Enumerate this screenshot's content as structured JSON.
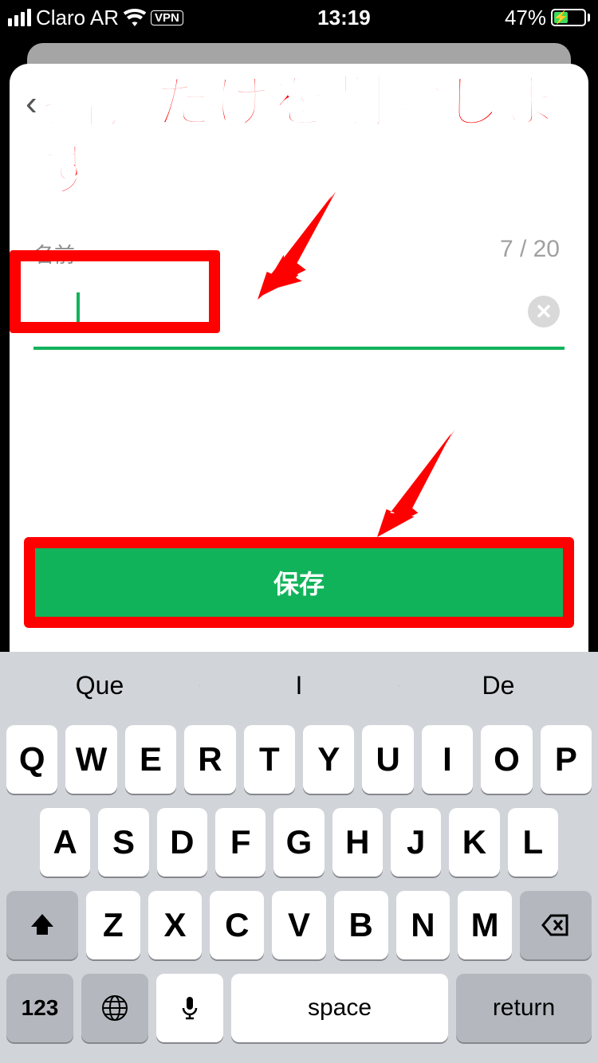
{
  "statusbar": {
    "carrier": "Claro AR",
    "vpn_label": "VPN",
    "time": "13:19",
    "battery_text": "47%",
    "battery_percent": 47
  },
  "annotation": {
    "title": "括弧だけを削除します"
  },
  "form": {
    "name_label": "名前",
    "name_value": "",
    "counter": "7 / 20",
    "save_label": "保存"
  },
  "keyboard": {
    "suggestions": [
      "Que",
      "I",
      "De"
    ],
    "row1": [
      "Q",
      "W",
      "E",
      "R",
      "T",
      "Y",
      "U",
      "I",
      "O",
      "P"
    ],
    "row2": [
      "A",
      "S",
      "D",
      "F",
      "G",
      "H",
      "J",
      "K",
      "L"
    ],
    "row3": [
      "Z",
      "X",
      "C",
      "V",
      "B",
      "N",
      "M"
    ],
    "mode_label": "123",
    "space_label": "space",
    "return_label": "return"
  }
}
